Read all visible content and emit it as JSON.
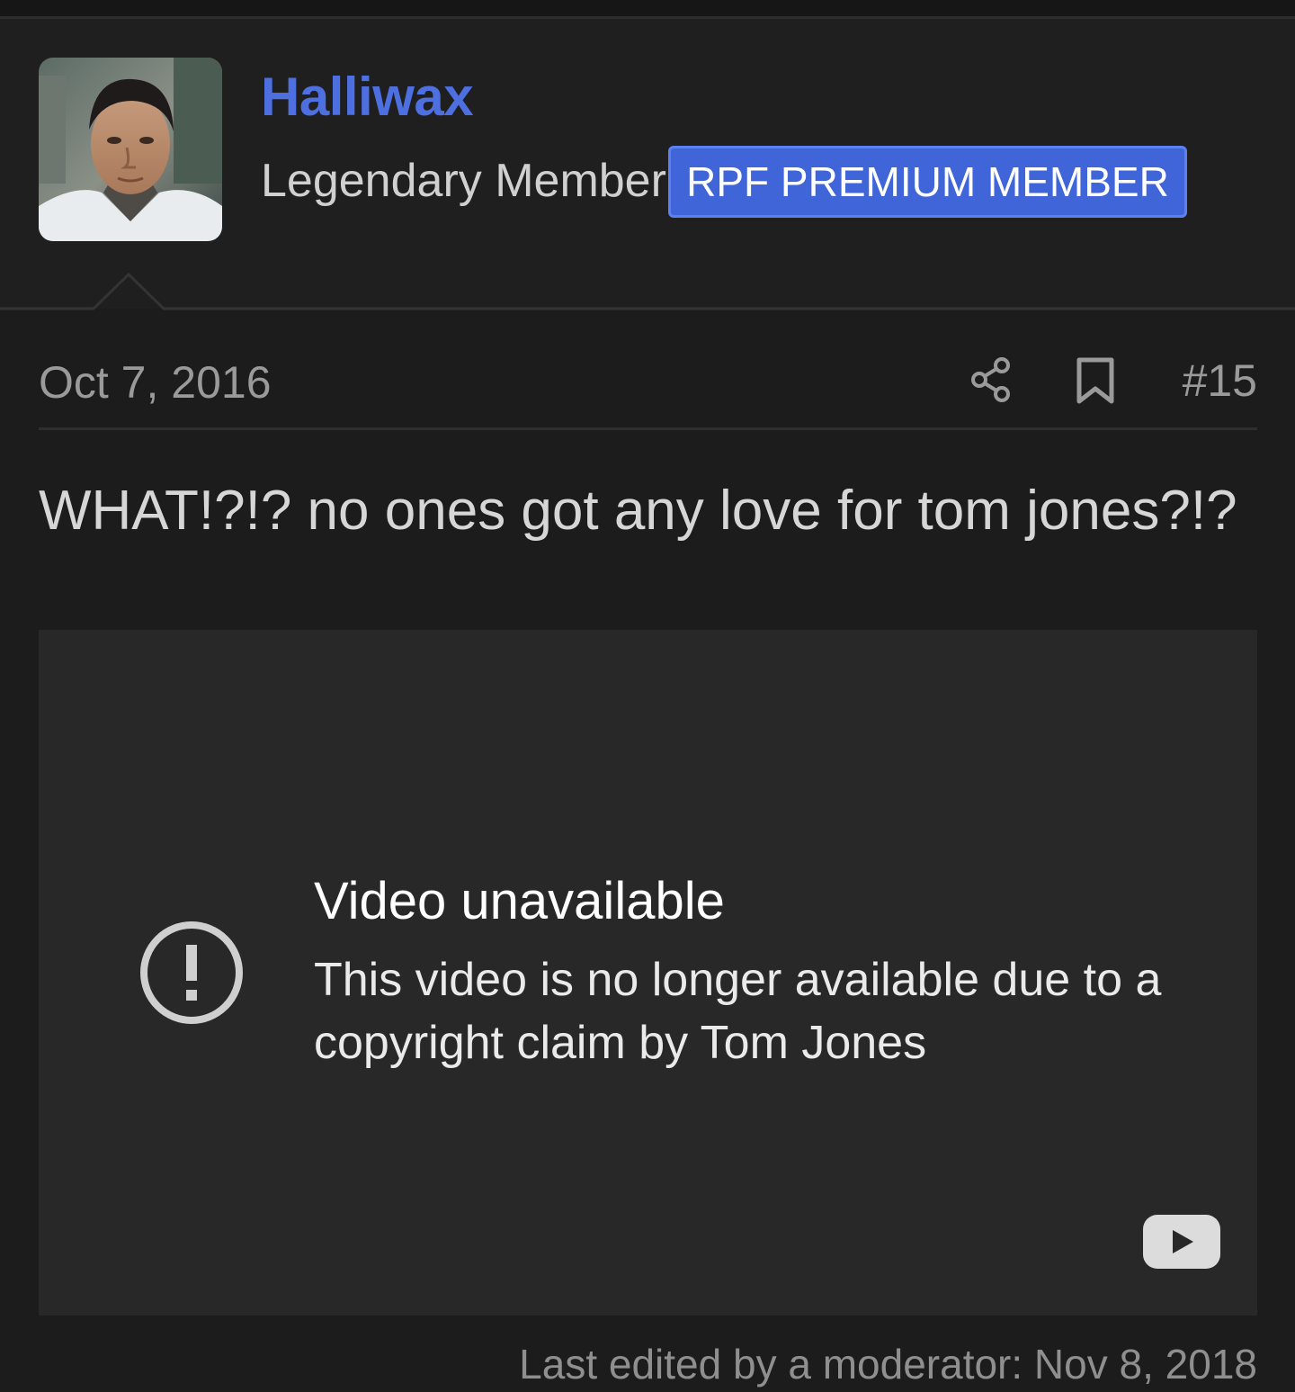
{
  "author": {
    "username": "Halliwax",
    "title": "Legendary Member",
    "badge": "RPF PREMIUM MEMBER",
    "username_color": "#4d6fe0",
    "badge_color": "#3f65d8"
  },
  "post": {
    "date": "Oct 7, 2016",
    "number": "#15",
    "body": "WHAT!?!? no ones got any love for tom jones?!?",
    "edit_note": "Last edited by a moderator: Nov 8, 2018"
  },
  "actions": {
    "share_icon": "share-icon",
    "bookmark_icon": "bookmark-icon"
  },
  "video": {
    "title": "Video unavailable",
    "message": "This video is no longer available due to a copyright claim by Tom Jones",
    "alert_icon": "exclamation-circle-icon",
    "logo_icon": "youtube-icon"
  },
  "theme": {
    "background": "#1c1c1c",
    "author_panel": "#1f1f1f",
    "embed_background": "#282828"
  }
}
